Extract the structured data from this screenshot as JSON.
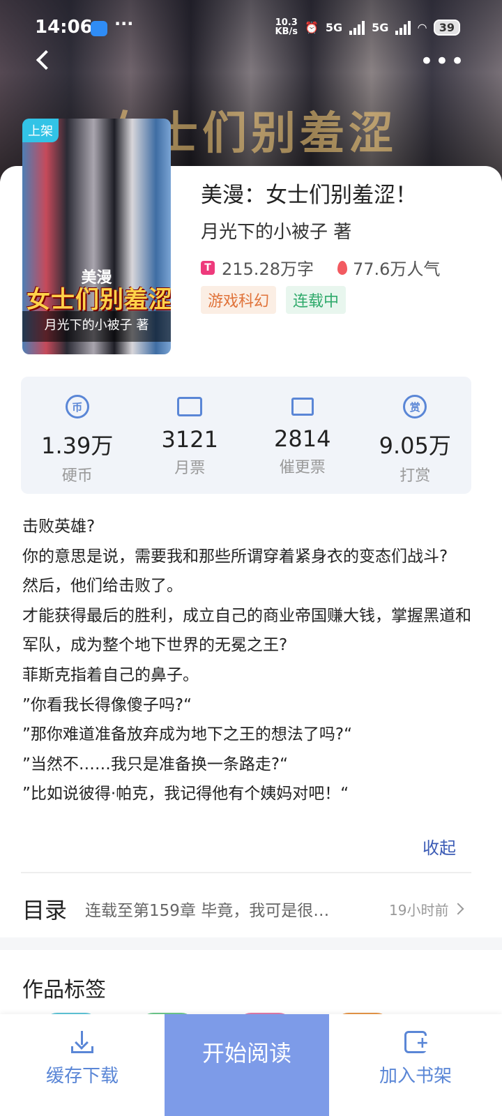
{
  "status_bar": {
    "time": "14:06",
    "more": "···",
    "net_speed_value": "10.3",
    "net_speed_unit": "KB/s",
    "sim1": "5G",
    "sim2": "5G",
    "battery": "39"
  },
  "header": {
    "banner_title": "女士们别羞涩",
    "more_label": "•••"
  },
  "book": {
    "cover_badge": "上架",
    "cover_subtitle": "美漫",
    "cover_title": "女士们别羞涩",
    "cover_author": "月光下的小被子 著",
    "title": "美漫：女士们别羞涩！",
    "author": "月光下的小被子 著",
    "word_count": "215.28万字",
    "popularity": "77.6万人气",
    "word_icon": "T",
    "tags": [
      "游戏科幻",
      "连载中"
    ]
  },
  "stats": [
    {
      "icon": "coin-icon",
      "glyph": "币",
      "value": "1.39万",
      "label": "硬币"
    },
    {
      "icon": "ticket-icon",
      "glyph": "",
      "value": "3121",
      "label": "月票"
    },
    {
      "icon": "urge-icon",
      "glyph": "",
      "value": "2814",
      "label": "催更票"
    },
    {
      "icon": "reward-icon",
      "glyph": "赏",
      "value": "9.05万",
      "label": "打赏"
    }
  ],
  "synopsis": {
    "lines": [
      "击败英雄?",
      "你的意思是说，需要我和那些所谓穿着紧身衣的变态们战斗?",
      "然后，他们给击败了。",
      "才能获得最后的胜利，成立自己的商业帝国赚大钱，掌握黑道和军队，成为整个地下世界的无冕之王?",
      "菲斯克指着自己的鼻子。",
      "”你看我长得像傻子吗?“",
      "”那你难道准备放弃成为地下之王的想法了吗?“",
      "”当然不……我只是准备换一条路走?“",
      "”比如说彼得·帕克，我记得他有个姨妈对吧！“"
    ],
    "collapse_label": "收起"
  },
  "toc": {
    "title": "目录",
    "latest": "连载至第159章  毕竟，我可是很…",
    "time": "19小时前"
  },
  "tags_section": {
    "title": "作品标签"
  },
  "bottom_bar": {
    "download_label": "缓存下载",
    "read_label": "开始阅读",
    "shelf_label": "加入书架"
  },
  "colors": {
    "accent": "#5a86d6",
    "read_button": "#7d9be8",
    "genre_tag": "#e0733a",
    "status_tag": "#2faa6b",
    "link": "#3b5bb5"
  }
}
